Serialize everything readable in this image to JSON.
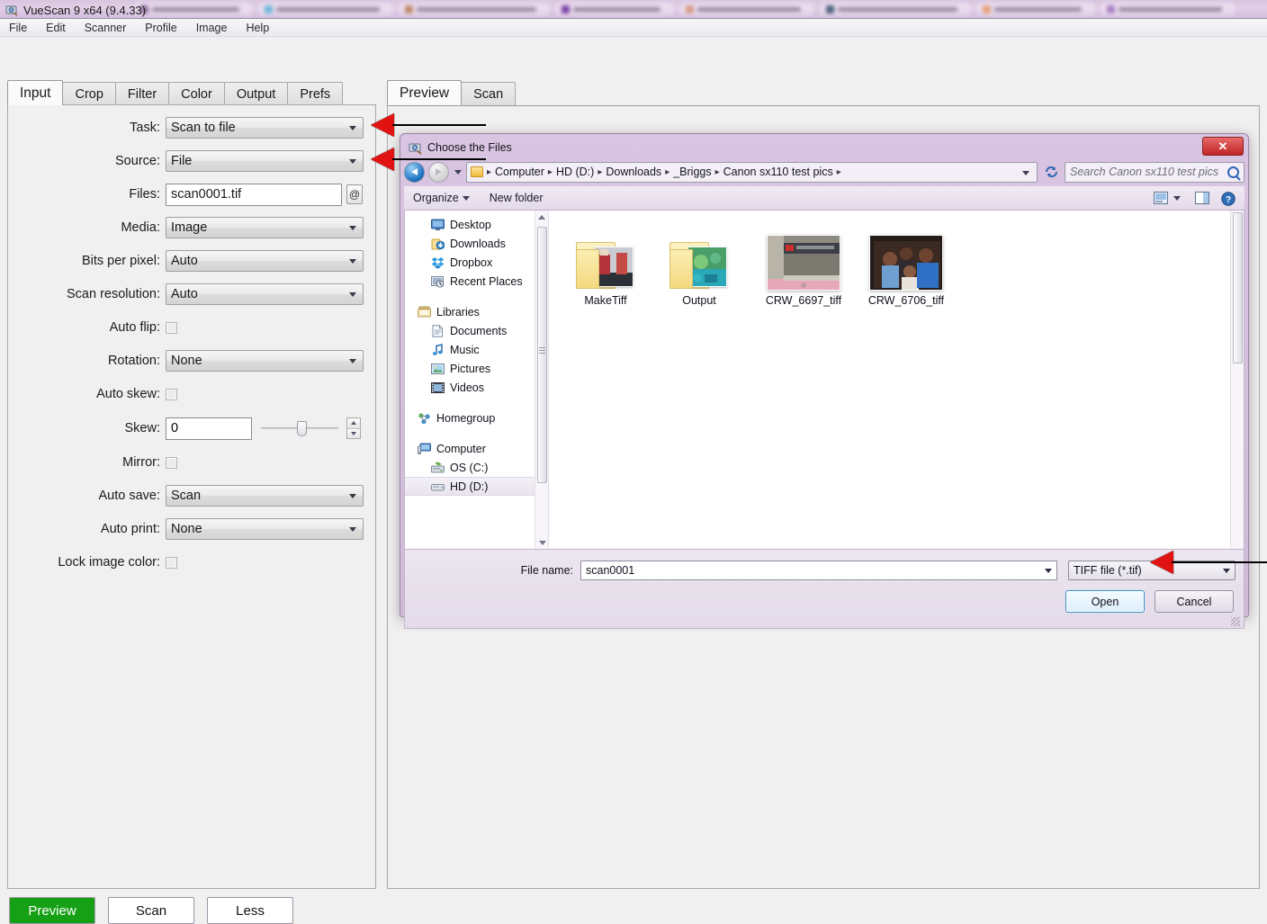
{
  "background_tabs": [
    {
      "color": "#8f6a9e"
    },
    {
      "color": "#6fb6d8"
    },
    {
      "color": "#c08a6a"
    },
    {
      "color": "#7b3fa0"
    },
    {
      "color": "#d79a86"
    },
    {
      "color": "#4a5f7a"
    },
    {
      "color": "#e8a07a"
    },
    {
      "color": "#a87fc0"
    }
  ],
  "app": {
    "title": "VueScan 9 x64 (9.4.33)",
    "icon": "vuescan-icon",
    "menu": [
      "File",
      "Edit",
      "Scanner",
      "Profile",
      "Image",
      "Help"
    ]
  },
  "tabs": [
    {
      "label": "Input",
      "active": true
    },
    {
      "label": "Crop",
      "active": false
    },
    {
      "label": "Filter",
      "active": false
    },
    {
      "label": "Color",
      "active": false
    },
    {
      "label": "Output",
      "active": false
    },
    {
      "label": "Prefs",
      "active": false
    }
  ],
  "input_panel": {
    "fields": [
      {
        "label": "Task:",
        "type": "combo",
        "value": "Scan to file"
      },
      {
        "label": "Source:",
        "type": "combo",
        "value": "File"
      },
      {
        "label": "Files:",
        "type": "text",
        "value": "scan0001.tif",
        "button": "@"
      },
      {
        "label": "Media:",
        "type": "combo",
        "value": "Image"
      },
      {
        "label": "Bits per pixel:",
        "type": "combo",
        "value": "Auto"
      },
      {
        "label": "Scan resolution:",
        "type": "combo",
        "value": "Auto"
      },
      {
        "label": "Auto flip:",
        "type": "check",
        "checked": false
      },
      {
        "label": "Rotation:",
        "type": "combo",
        "value": "None"
      },
      {
        "label": "Auto skew:",
        "type": "check",
        "checked": false
      },
      {
        "label": "Skew:",
        "type": "slider",
        "value": "0"
      },
      {
        "label": "Mirror:",
        "type": "check",
        "checked": false
      },
      {
        "label": "Auto save:",
        "type": "combo",
        "value": "Scan"
      },
      {
        "label": "Auto print:",
        "type": "combo",
        "value": "None"
      },
      {
        "label": "Lock image color:",
        "type": "check",
        "checked": false
      }
    ]
  },
  "preview_tabs": [
    {
      "label": "Preview",
      "active": true
    },
    {
      "label": "Scan",
      "active": false
    }
  ],
  "bottom_buttons": [
    {
      "label": "Preview",
      "style": "green"
    },
    {
      "label": "Scan",
      "style": "normal"
    },
    {
      "label": "Less",
      "style": "normal"
    }
  ],
  "file_dialog": {
    "title": "Choose the Files",
    "close_label": "✕",
    "breadcrumb": [
      "Computer",
      "HD (D:)",
      "Downloads",
      "_Briggs",
      "Canon sx110 test pics"
    ],
    "search_placeholder": "Search Canon sx110 test pics",
    "toolbar": {
      "organize": "Organize",
      "new_folder": "New folder",
      "view_icon": "view-layout-icon",
      "preview_pane_icon": "preview-pane-icon",
      "help_icon": "help-icon"
    },
    "sidebar": [
      {
        "label": "Desktop",
        "icon": "desktop-icon",
        "indent": true,
        "selected": false
      },
      {
        "label": "Downloads",
        "icon": "downloads-icon",
        "indent": true,
        "selected": false
      },
      {
        "label": "Dropbox",
        "icon": "dropbox-icon",
        "indent": true,
        "selected": false
      },
      {
        "label": "Recent Places",
        "icon": "recent-places-icon",
        "indent": true,
        "selected": false
      },
      {
        "gap": true
      },
      {
        "label": "Libraries",
        "icon": "libraries-icon",
        "indent": false,
        "selected": false
      },
      {
        "label": "Documents",
        "icon": "documents-icon",
        "indent": true,
        "selected": false
      },
      {
        "label": "Music",
        "icon": "music-icon",
        "indent": true,
        "selected": false
      },
      {
        "label": "Pictures",
        "icon": "pictures-icon",
        "indent": true,
        "selected": false
      },
      {
        "label": "Videos",
        "icon": "videos-icon",
        "indent": true,
        "selected": false
      },
      {
        "gap": true
      },
      {
        "label": "Homegroup",
        "icon": "homegroup-icon",
        "indent": false,
        "selected": false
      },
      {
        "gap": true
      },
      {
        "label": "Computer",
        "icon": "computer-icon",
        "indent": false,
        "selected": false
      },
      {
        "label": "OS (C:)",
        "icon": "os-drive-icon",
        "indent": true,
        "selected": false
      },
      {
        "label": "HD (D:)",
        "icon": "hd-drive-icon",
        "indent": true,
        "selected": true
      }
    ],
    "files": [
      {
        "name": "MakeTiff",
        "type": "folder"
      },
      {
        "name": "Output",
        "type": "folder"
      },
      {
        "name": "CRW_6697_tiff",
        "type": "photo"
      },
      {
        "name": "CRW_6706_tiff",
        "type": "photo"
      }
    ],
    "file_name_label": "File name:",
    "file_name_value": "scan0001",
    "file_type_value": "TIFF file (*.tif)",
    "open_label": "Open",
    "cancel_label": "Cancel"
  },
  "annotations": [
    {
      "name": "arrow-source",
      "target": "Source field"
    },
    {
      "name": "arrow-files",
      "target": "Files field"
    },
    {
      "name": "arrow-filetype",
      "target": "File type combo"
    }
  ],
  "colors": {
    "accent_green": "#16a016",
    "arrow_red": "#e11212",
    "dialog_chrome": "#d9c5e1",
    "close_red": "#c02626"
  }
}
